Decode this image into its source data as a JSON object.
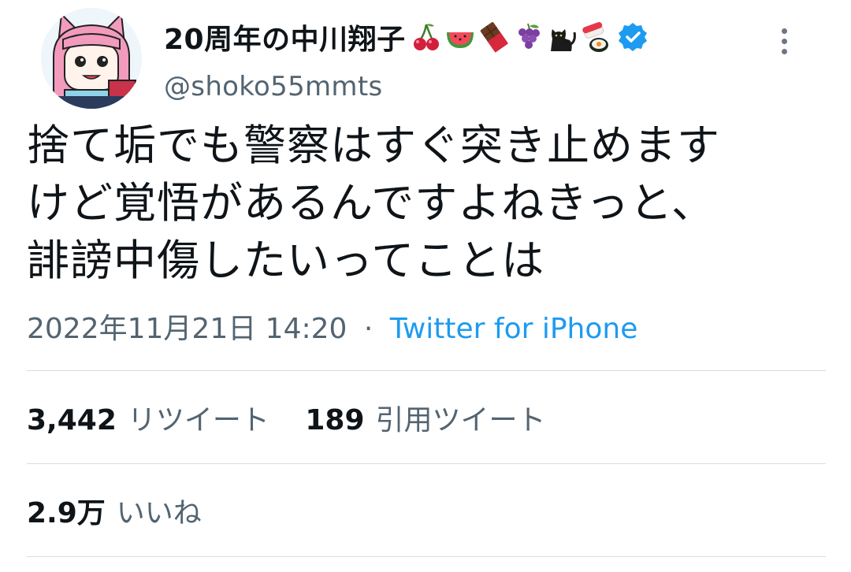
{
  "user": {
    "display_name": "20周年の中川翔子",
    "handle": "@shoko55mmts",
    "name_emojis": [
      "cherries-icon",
      "watermelon-icon",
      "chocolate-bar-icon",
      "grapes-icon",
      "black-cat-icon",
      "sushi-icon"
    ],
    "verified_icon": "verified-badge-icon",
    "verified_color": "#1d9bf0"
  },
  "tweet": {
    "lines": [
      "捨て垢でも警察はすぐ突き止めます",
      "けど覚悟があるんですよねきっと、",
      "誹謗中傷したいってことは"
    ],
    "timestamp": "2022年11月21日 14:20",
    "separator": "·",
    "source": "Twitter for iPhone"
  },
  "stats": {
    "retweets_count": "3,442",
    "retweets_label": "リツイート",
    "quotes_count": "189",
    "quotes_label": "引用ツイート",
    "likes_count": "2.9万",
    "likes_label": "いいね"
  },
  "colors": {
    "text": "#0f1419",
    "secondary": "#536471",
    "link": "#1d9bf0",
    "divider": "#d6dde3"
  }
}
